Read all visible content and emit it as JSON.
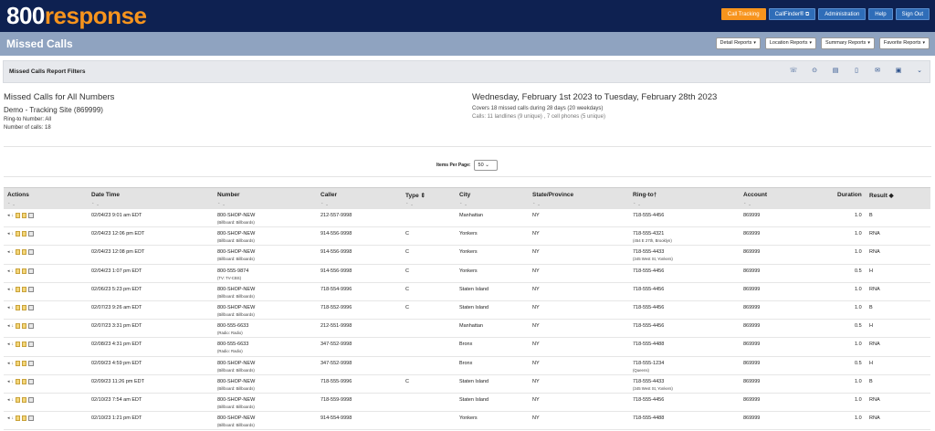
{
  "app": {
    "logo_prefix": "800",
    "logo_suffix": "response",
    "nav": [
      "Call Tracking",
      "CallFinder® ⧉",
      "Administration",
      "Help",
      "Sign Out"
    ]
  },
  "page": {
    "title": "Missed Calls",
    "report_menus": [
      "Detail Reports",
      "Location Reports",
      "Summary Reports",
      "Favorite Reports"
    ]
  },
  "filters": {
    "title": "Missed Calls Report Filters",
    "icons": [
      "phone-back-icon",
      "phone-search-icon",
      "export-excel-icon",
      "export-pdf-icon",
      "email-icon",
      "save-icon",
      "chevron-down-icon"
    ]
  },
  "summary": {
    "heading": "Missed Calls for All Numbers",
    "site": "Demo - Tracking Site (869999)",
    "ring_to": "Ring-to Number: All",
    "count": "Number of calls: 18",
    "date_range": "Wednesday, February 1st 2023 to Tuesday, February 28th 2023",
    "covers": "Covers 18 missed calls during 28 days (20 weekdays)",
    "breakdown": "Calls: 11 landlines (9 unique) , 7 cell phones (5 unique)"
  },
  "pagination": {
    "label": "Items Per Page:",
    "value": "50"
  },
  "table": {
    "headers": {
      "actions": "Actions",
      "datetime": "Date Time",
      "number": "Number",
      "caller": "Caller",
      "type": "Type ⇕",
      "city": "City",
      "state": "State/Province",
      "ringto": "Ring-to†",
      "account": "Account",
      "duration": "Duration",
      "result": "Result ◆"
    },
    "rows": [
      {
        "datetime": "02/04/23 9:01 am EDT",
        "number": "800-SHOP-NEW",
        "source": "(Billboard: Billboards)",
        "caller": "212-557-9998",
        "type": "",
        "city": "Manhattan",
        "state": "NY",
        "ringto": "718-555-4456",
        "ringto_addr": "",
        "account": "869999",
        "duration": "1.0",
        "result": "B"
      },
      {
        "datetime": "02/04/23 12:06 pm EDT",
        "number": "800-SHOP-NEW",
        "source": "(Billboard: Billboards)",
        "caller": "914-556-9998",
        "type": "C",
        "city": "Yonkers",
        "state": "NY",
        "ringto": "718-555-4321",
        "ringto_addr": "(454 E 27th, Brooklyn)",
        "account": "869999",
        "duration": "1.0",
        "result": "RNA"
      },
      {
        "datetime": "02/04/23 12:08 pm EDT",
        "number": "800-SHOP-NEW",
        "source": "(Billboard: Billboards)",
        "caller": "914-556-9998",
        "type": "C",
        "city": "Yonkers",
        "state": "NY",
        "ringto": "718-555-4433",
        "ringto_addr": "(345 West St, Yonkers)",
        "account": "869999",
        "duration": "1.0",
        "result": "RNA"
      },
      {
        "datetime": "02/04/23 1:07 pm EDT",
        "number": "800-555-9874",
        "source": "(TV: TV-CBS)",
        "caller": "914-556-9998",
        "type": "C",
        "city": "Yonkers",
        "state": "NY",
        "ringto": "718-555-4456",
        "ringto_addr": "",
        "account": "869999",
        "duration": "0.5",
        "result": "H"
      },
      {
        "datetime": "02/06/23 5:23 pm EDT",
        "number": "800-SHOP-NEW",
        "source": "(Billboard: Billboards)",
        "caller": "718-554-9996",
        "type": "C",
        "city": "Staten Island",
        "state": "NY",
        "ringto": "718-555-4456",
        "ringto_addr": "",
        "account": "869999",
        "duration": "1.0",
        "result": "RNA"
      },
      {
        "datetime": "02/07/23 9:26 am EDT",
        "number": "800-SHOP-NEW",
        "source": "(Billboard: Billboards)",
        "caller": "718-552-9996",
        "type": "C",
        "city": "Staten Island",
        "state": "NY",
        "ringto": "718-555-4456",
        "ringto_addr": "",
        "account": "869999",
        "duration": "1.0",
        "result": "B"
      },
      {
        "datetime": "02/07/23 3:31 pm EDT",
        "number": "800-555-6633",
        "source": "(Radio: Radio)",
        "caller": "212-551-9998",
        "type": "",
        "city": "Manhattan",
        "state": "NY",
        "ringto": "718-555-4456",
        "ringto_addr": "",
        "account": "869999",
        "duration": "0.5",
        "result": "H"
      },
      {
        "datetime": "02/08/23 4:31 pm EDT",
        "number": "800-555-6633",
        "source": "(Radio: Radio)",
        "caller": "347-552-9998",
        "type": "",
        "city": "Bronx",
        "state": "NY",
        "ringto": "718-555-4488",
        "ringto_addr": "",
        "account": "869999",
        "duration": "1.0",
        "result": "RNA"
      },
      {
        "datetime": "02/09/23 4:59 pm EDT",
        "number": "800-SHOP-NEW",
        "source": "(Billboard: Billboards)",
        "caller": "347-552-9998",
        "type": "",
        "city": "Bronx",
        "state": "NY",
        "ringto": "718-555-1234",
        "ringto_addr": "(Queens)",
        "account": "869999",
        "duration": "0.5",
        "result": "H"
      },
      {
        "datetime": "02/09/23 11:26 pm EDT",
        "number": "800-SHOP-NEW",
        "source": "(Billboard: Billboards)",
        "caller": "718-555-9996",
        "type": "C",
        "city": "Staten Island",
        "state": "NY",
        "ringto": "718-555-4433",
        "ringto_addr": "(345 West St, Yonkers)",
        "account": "869999",
        "duration": "1.0",
        "result": "B"
      },
      {
        "datetime": "02/10/23 7:54 am EDT",
        "number": "800-SHOP-NEW",
        "source": "(Billboard: Billboards)",
        "caller": "718-559-9998",
        "type": "",
        "city": "Staten Island",
        "state": "NY",
        "ringto": "718-555-4456",
        "ringto_addr": "",
        "account": "869999",
        "duration": "1.0",
        "result": "RNA"
      },
      {
        "datetime": "02/10/23 1:21 pm EDT",
        "number": "800-SHOP-NEW",
        "source": "(Billboard: Billboards)",
        "caller": "914-554-9998",
        "type": "",
        "city": "Yonkers",
        "state": "NY",
        "ringto": "718-555-4488",
        "ringto_addr": "",
        "account": "869999",
        "duration": "1.0",
        "result": "RNA"
      }
    ]
  }
}
